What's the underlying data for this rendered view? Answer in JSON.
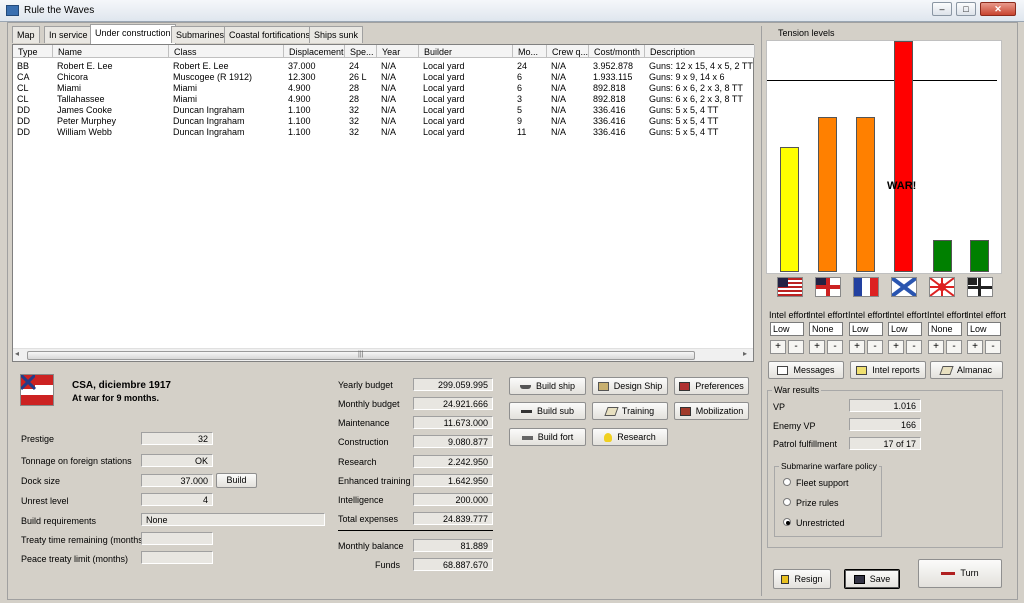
{
  "window": {
    "title": "Rule the Waves",
    "min": "–",
    "max": "□",
    "close": "✕"
  },
  "tabs": [
    "Map",
    "In service",
    "Under construction",
    "Submarines",
    "Coastal fortifications",
    "Ships sunk"
  ],
  "table": {
    "columns": [
      "Type",
      "Name",
      "Class",
      "Displacement",
      "Spe...",
      "Year",
      "Builder",
      "Mo...",
      "Crew q...",
      "Cost/month",
      "Description"
    ],
    "rows": [
      [
        "BB",
        "Robert E. Lee",
        "Robert E. Lee",
        "37.000",
        "24",
        "N/A",
        "Local yard",
        "24",
        "N/A",
        "3.952.878",
        "Guns: 12 x 15, 4 x 5, 2 TT"
      ],
      [
        "CA",
        "Chicora",
        "Muscogee (R 1912)",
        "12.300",
        "26 L",
        "N/A",
        "Local yard",
        "6",
        "N/A",
        "1.933.115",
        "Guns: 9 x 9, 14 x 6"
      ],
      [
        "CL",
        "Miami",
        "Miami",
        "4.900",
        "28",
        "N/A",
        "Local yard",
        "6",
        "N/A",
        "892.818",
        "Guns: 6 x 6, 2 x 3, 8 TT"
      ],
      [
        "CL",
        "Tallahassee",
        "Miami",
        "4.900",
        "28",
        "N/A",
        "Local yard",
        "3",
        "N/A",
        "892.818",
        "Guns: 6 x 6, 2 x 3, 8 TT"
      ],
      [
        "DD",
        "James Cooke",
        "Duncan Ingraham",
        "1.100",
        "32",
        "N/A",
        "Local yard",
        "5",
        "N/A",
        "336.416",
        "Guns: 5 x 5, 4 TT"
      ],
      [
        "DD",
        "Peter Murphey",
        "Duncan Ingraham",
        "1.100",
        "32",
        "N/A",
        "Local yard",
        "9",
        "N/A",
        "336.416",
        "Guns: 5 x 5, 4 TT"
      ],
      [
        "DD",
        "William Webb",
        "Duncan Ingraham",
        "1.100",
        "32",
        "N/A",
        "Local yard",
        "11",
        "N/A",
        "336.416",
        "Guns: 5 x 5, 4 TT"
      ]
    ],
    "scroll_grip": "|||"
  },
  "nation": {
    "line1": "CSA, diciembre 1917",
    "line2": "At war for 9 months."
  },
  "status": [
    {
      "label": "Prestige",
      "value": "32"
    },
    {
      "label": "Tonnage on foreign stations",
      "value": "OK"
    },
    {
      "label": "Dock size",
      "value": "37.000",
      "button": "Build"
    },
    {
      "label": "Unrest level",
      "value": "4"
    },
    {
      "label": "Build requirements",
      "value": "None"
    },
    {
      "label": "Treaty time remaining (months)",
      "value": ""
    },
    {
      "label": "Peace treaty limit (months)",
      "value": ""
    }
  ],
  "budget": [
    {
      "label": "Yearly budget",
      "value": "299.059.995"
    },
    {
      "label": "Monthly budget",
      "value": "24.921.666"
    },
    {
      "label": "Maintenance",
      "value": "11.673.000"
    },
    {
      "label": "Construction",
      "value": "9.080.877"
    },
    {
      "label": "Research",
      "value": "2.242.950"
    },
    {
      "label": "Enhanced training",
      "value": "1.642.950"
    },
    {
      "label": "Intelligence",
      "value": "200.000"
    },
    {
      "label": "Total expenses",
      "value": "24.839.777"
    },
    {
      "label": "Monthly balance",
      "value": "81.889"
    },
    {
      "label": "Funds",
      "value": "68.887.670"
    }
  ],
  "actions": {
    "build_ship": "Build ship",
    "design_ship": "Design Ship",
    "preferences": "Preferences",
    "build_sub": "Build sub",
    "training": "Training",
    "mobilization": "Mobilization",
    "build_fort": "Build fort",
    "research": "Research"
  },
  "tension": {
    "title": "Tension levels",
    "war_label": "WAR!",
    "levels": [
      0.54,
      0.67,
      0.67,
      1.0,
      0.14,
      0.14
    ],
    "threshold": 0.83,
    "colors": [
      "#ffff00",
      "#ff8000",
      "#ff8000",
      "#ff0000",
      "#008000",
      "#008000"
    ],
    "flags": [
      "usa-flag",
      "britain-flag",
      "france-flag",
      "russia-flag",
      "japan-flag",
      "germany-flag"
    ],
    "intel_label": "Intel effort",
    "intel": [
      "Low",
      "None",
      "Low",
      "Low",
      "None",
      "Low"
    ],
    "plus": "+",
    "minus": "-"
  },
  "panel_buttons": {
    "messages": "Messages",
    "intel_reports": "Intel reports",
    "almanac": "Almanac"
  },
  "war_results": {
    "title": "War results",
    "items": [
      {
        "label": "VP",
        "value": "1.016"
      },
      {
        "label": "Enemy VP",
        "value": "166"
      },
      {
        "label": "Patrol fulfillment",
        "value": "17 of 17"
      }
    ]
  },
  "sub_policy": {
    "title": "Submarine warfare policy",
    "options": [
      "Fleet support",
      "Prize rules",
      "Unrestricted"
    ],
    "selected": 2
  },
  "bottom": {
    "resign": "Resign",
    "save": "Save",
    "turn": "Turn"
  }
}
